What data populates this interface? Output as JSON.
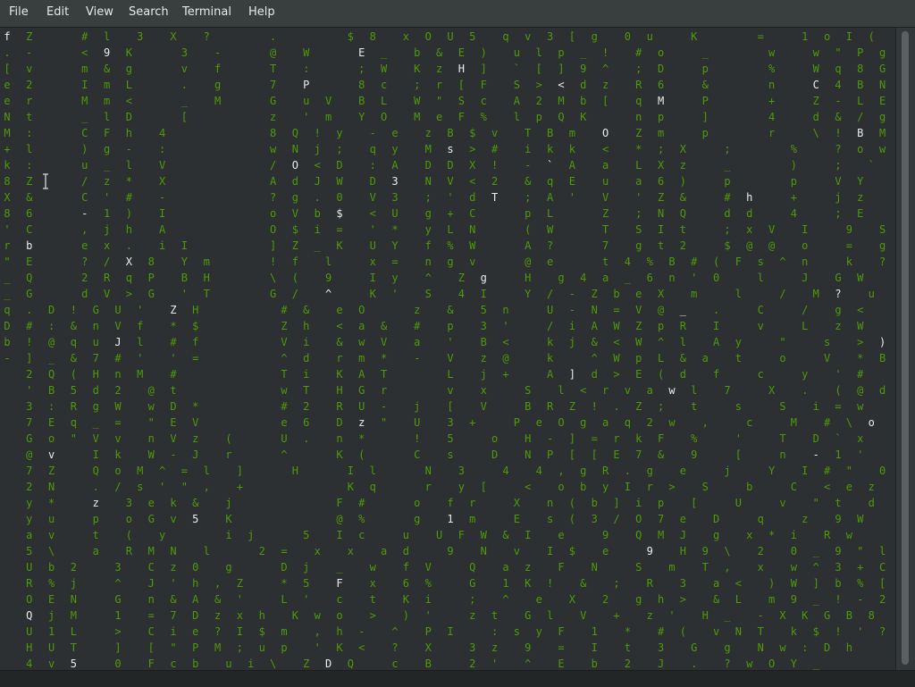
{
  "menu": {
    "file": "File",
    "edit": "Edit",
    "view": "View",
    "search": "Search",
    "terminal": "Terminal",
    "help": "Help"
  },
  "colors": {
    "background": "#2d3032",
    "menubar": "#393f3f",
    "green_text": "#4e9a06",
    "bright_text": "#ececec"
  },
  "cursor_icon": "i-beam-cursor-icon",
  "terminal_lines": [
    "f Z    # l  3  X  ?     .      $ 8  x O U 5  q v 3 [ g  0 u   K     =   1 o I ( s / 4 U m  # m U",
    ". -    < 9 K    3  -    @  W    E _  b & E )  u l p _ !  # o   _     w   w \" P g B  ) j '  V t",
    "[ v    m & g    v  f    T  :    ; W  K z H ]  ` [ ] 9 ^  ; D   p     %   W q 8 G 6  e . r  ( ?",
    "e 2    I m L    .  g    7  P    8 c  ; r [ F  S > < d z  R 6   &     n   C 4 B N X 6 i _ _  E E",
    "e r    M m <    _  M    G  u V  B L  W \" S c  A 2 M b [  q M   P     +   Z - L E J w  , % a @   B",
    "N t    _ l D    [       z  ' m  Y O  M e F %  l p Q K    n p   ]     4   d & / g N >  p ,  U 7   h ) p",
    "M :    C F h  4         8 Q ! y  - e  z B $ v  T B m  O  Z m   p     r   \\ ! B M B L   k t   ` ? m",
    "+ l    ) g -  :         w N j ;  q y  M s > #  i k k  <  * ; X   ;     %   ? o w 5 U Y  a 9 M  W * j",
    "k :    u _ l  V         / O < D  : A  D D X !  - ` A  a  L X z   _     )   ;  ` R H z  \" P @  4 !",
    "8 Z    / z *  X         A d J W  D 3  N V < 2  & q E  u  a 6 )   p     p   V Y  U X  7  r Y L  6 )",
    "X &    C ' #  -         ? g . 0  V 3  ; ' d T  ; A '  V  ' Z &   # h   +   j z  f q  e  X N -  ; g",
    "8 6    - 1 )  I         o V b $  < U  g + C    p L    Z  ; N Q   d d   4   ; E  I \\  Z  C d o  J s",
    "' C    , j h  A         O $ i =  ' *  y L N    ( W    T  S I t   ; x V  I   9  S T k  K  L N <  J A",
    "r b    e x .  i I       ] Z _ K  U Y  f % W    A ?    7  g t 2   $ @ @  o   =  g  \" C  c  i p /  G u l",
    "\" E    ? / X 8  Y m     ! f  l   x =  n g v    @ e    t 4 % B # ( F s ^ n   k  ? 4  V  O H >  ! _ 7",
    "_ Q    2 R q P  B H     \\ (  9   I y  ^  Z g   H  g 4 a _ 6 n ' 0   l   J  G W  F  , V T  # p ]",
    "_ G    d V > G  ' T     G /  ^   K '  S  4 I   Y / - Z b e X  m   l   /  M ?  u  Z z   _ * 2",
    "q . D ! G U '  Z H       # &  e O    z  &  5 n   U - N = V @ _  .   C   /  g <  l  f j   v ! $",
    "D # : & n V f  * $       Z h  < a &  #  p  3 '   / i A W Z p R  I   v   L  z W  v  * U   1 f T",
    "b ! @ q u J l  # f       V i  & w V  a  '  B <   k j & < W ^ l  A y   \"   s  > )  A  u Q   M H 5",
    "- ] _ & 7 # '  ' =       ^ d  r m *  -  V  z @   k   ^ W p L & a  t   o   V  * B  g  C G   g R /",
    "  2 Q ( H n M  #         T i  K A T     L  j +   A ] d > E ( d  f   c   y  ' #  a  $     , l",
    "  ' B 5 d 2  @ t         w T  H G r     v  x   S  l < r v a w l  7   X  .  ( @ d  s  M   B !",
    "  3 : R g W  w D *       # 2  R U -  j  [  V   B R Z ! . Z ;  t   s   S  i = w  ?  h   & 0",
    "  7 E q _ =  \" E V       e 6  D z \"  U  3 +   P e O g a q 2 w  ,   c   M  # \\ o  @  B  u s t",
    "  G o \" V v  n V z  (    U .  n *    !  5   o  H - ] = r k F  %   '   T  D ` x  _  l  N J ] x",
    "  @ v   I k  W - J  r    ^    K (    C  s   D  N P [ [ E 7 &  9   [   n  - 1 '  I  o g ^ + 1",
    "  7 Z   Q o M ^ = l  ]    H    I l    N  3   4  4 , g R . g  e   j   Y  I # \"  0  d <  G Y",
    "  2 N   . / s ' \" ,  +         K q    r  y [   <  o b y I r >  S   b   C  < e z  Q  S G  L ^",
    "  y *   z  3 e k &  j         F #    o  f r   X  n ( b ] i p  [   U   v  \" t  d  N q  . a",
    "  y u   p  o G v 5  K         @ %    g  1 m   E  s ( 3 / O 7 e  D   q   z  9 W  Y  \\ *  8 T",
    "  a v   t  (  y     i j    5  I c   u  U F W & I  e   9  Q M J  g  x * i  R w",
    "  5 \\   a  R M N  l    2 =  x  x  a d   9  N  v  I $  e   9  H 9 \\  2  0 _ 9 \" l $",
    "  U b 2   3  C z 0  g    D j  _  w  f V   Q  a z  F  N   S  m  T ,  x  w ^ 3 + C K",
    "  R % j   ^  J ' h , Z   * 5  F  x  6 %   G  1 K !  &  ;  R  3  a <  ) W ] b % [",
    "  O E N   G  n & A & '   L '  c  t  K i   ;  ^  e  X  2  g h >  & L  m 9 _ ! - 2",
    "  Q j M   1  = 7 D z x h  K w o  >  ) '   z t  G l  V  +  z '  H _  - X K G B 8 r",
    "  U 1 L   >  C i e ? I $ m  , h -  ^  P I   : s y F  1  *  # (  v N T  k $ ! ' ? P",
    "  H U T   ]  [ \" P M ; u p  ' K <  ?  X   3 z  9  =  I  t  3  G  g  N w : D h",
    "  4 v 5   0  F c b  u i \\  Z D Q   c  B   2 '  ^  E  b  2  J  .  ? w O Y _"
  ]
}
